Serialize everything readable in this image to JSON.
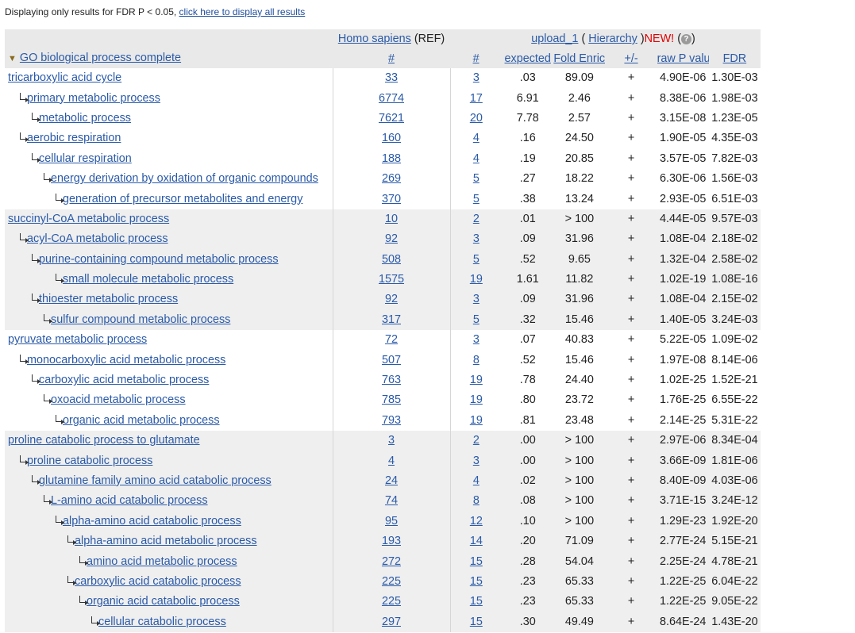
{
  "notice": {
    "text": "Displaying only results for FDR P < 0.05, ",
    "link": "click here to display all results"
  },
  "header": {
    "ref_species": "Homo sapiens",
    "ref_tag": "(REF)",
    "upload_label": "upload_1",
    "paren_open": "(",
    "hierarchy_label": "Hierarchy",
    "paren_close": ")",
    "new_label": "NEW!",
    "help_icon": "?",
    "help_close": ")",
    "annotation_set": "GO biological process complete",
    "cols": {
      "ref_count": "#",
      "count": "#",
      "expected": "expected",
      "fold": "Fold Enrichment",
      "plusminus": "+/-",
      "raw_p": "raw P value",
      "fdr": "FDR"
    }
  },
  "rows": [
    {
      "indent": 0,
      "name": "tricarboxylic acid cycle",
      "ref": "33",
      "n": "3",
      "expected": ".03",
      "fold": "89.09",
      "pm": "+",
      "raw": "4.90E-06",
      "fdr": "1.30E-03",
      "group": 0
    },
    {
      "indent": 1,
      "name": "primary metabolic process",
      "ref": "6774",
      "n": "17",
      "expected": "6.91",
      "fold": "2.46",
      "pm": "+",
      "raw": "8.38E-06",
      "fdr": "1.98E-03",
      "group": 0
    },
    {
      "indent": 2,
      "name": "metabolic process",
      "ref": "7621",
      "n": "20",
      "expected": "7.78",
      "fold": "2.57",
      "pm": "+",
      "raw": "3.15E-08",
      "fdr": "1.23E-05",
      "group": 0
    },
    {
      "indent": 1,
      "name": "aerobic respiration",
      "ref": "160",
      "n": "4",
      "expected": ".16",
      "fold": "24.50",
      "pm": "+",
      "raw": "1.90E-05",
      "fdr": "4.35E-03",
      "group": 0
    },
    {
      "indent": 2,
      "name": "cellular respiration",
      "ref": "188",
      "n": "4",
      "expected": ".19",
      "fold": "20.85",
      "pm": "+",
      "raw": "3.57E-05",
      "fdr": "7.82E-03",
      "group": 0
    },
    {
      "indent": 3,
      "name": "energy derivation by oxidation of organic compounds",
      "ref": "269",
      "n": "5",
      "expected": ".27",
      "fold": "18.22",
      "pm": "+",
      "raw": "6.30E-06",
      "fdr": "1.56E-03",
      "group": 0
    },
    {
      "indent": 4,
      "name": "generation of precursor metabolites and energy",
      "ref": "370",
      "n": "5",
      "expected": ".38",
      "fold": "13.24",
      "pm": "+",
      "raw": "2.93E-05",
      "fdr": "6.51E-03",
      "group": 0
    },
    {
      "indent": 0,
      "name": "succinyl-CoA metabolic process",
      "ref": "10",
      "n": "2",
      "expected": ".01",
      "fold": "> 100",
      "pm": "+",
      "raw": "4.44E-05",
      "fdr": "9.57E-03",
      "group": 1
    },
    {
      "indent": 1,
      "name": "acyl-CoA metabolic process",
      "ref": "92",
      "n": "3",
      "expected": ".09",
      "fold": "31.96",
      "pm": "+",
      "raw": "1.08E-04",
      "fdr": "2.18E-02",
      "group": 1
    },
    {
      "indent": 2,
      "name": "purine-containing compound metabolic process",
      "ref": "508",
      "n": "5",
      "expected": ".52",
      "fold": "9.65",
      "pm": "+",
      "raw": "1.32E-04",
      "fdr": "2.58E-02",
      "group": 1
    },
    {
      "indent": 4,
      "name": "small molecule metabolic process",
      "ref": "1575",
      "n": "19",
      "expected": "1.61",
      "fold": "11.82",
      "pm": "+",
      "raw": "1.02E-19",
      "fdr": "1.08E-16",
      "group": 1
    },
    {
      "indent": 2,
      "name": "thioester metabolic process",
      "ref": "92",
      "n": "3",
      "expected": ".09",
      "fold": "31.96",
      "pm": "+",
      "raw": "1.08E-04",
      "fdr": "2.15E-02",
      "group": 1
    },
    {
      "indent": 3,
      "name": "sulfur compound metabolic process",
      "ref": "317",
      "n": "5",
      "expected": ".32",
      "fold": "15.46",
      "pm": "+",
      "raw": "1.40E-05",
      "fdr": "3.24E-03",
      "group": 1
    },
    {
      "indent": 0,
      "name": "pyruvate metabolic process",
      "ref": "72",
      "n": "3",
      "expected": ".07",
      "fold": "40.83",
      "pm": "+",
      "raw": "5.22E-05",
      "fdr": "1.09E-02",
      "group": 0
    },
    {
      "indent": 1,
      "name": "monocarboxylic acid metabolic process",
      "ref": "507",
      "n": "8",
      "expected": ".52",
      "fold": "15.46",
      "pm": "+",
      "raw": "1.97E-08",
      "fdr": "8.14E-06",
      "group": 0
    },
    {
      "indent": 2,
      "name": "carboxylic acid metabolic process",
      "ref": "763",
      "n": "19",
      "expected": ".78",
      "fold": "24.40",
      "pm": "+",
      "raw": "1.02E-25",
      "fdr": "1.52E-21",
      "group": 0
    },
    {
      "indent": 3,
      "name": "oxoacid metabolic process",
      "ref": "785",
      "n": "19",
      "expected": ".80",
      "fold": "23.72",
      "pm": "+",
      "raw": "1.76E-25",
      "fdr": "6.55E-22",
      "group": 0
    },
    {
      "indent": 4,
      "name": "organic acid metabolic process",
      "ref": "793",
      "n": "19",
      "expected": ".81",
      "fold": "23.48",
      "pm": "+",
      "raw": "2.14E-25",
      "fdr": "5.31E-22",
      "group": 0
    },
    {
      "indent": 0,
      "name": "proline catabolic process to glutamate",
      "ref": "3",
      "n": "2",
      "expected": ".00",
      "fold": "> 100",
      "pm": "+",
      "raw": "2.97E-06",
      "fdr": "8.34E-04",
      "group": 1
    },
    {
      "indent": 1,
      "name": "proline catabolic process",
      "ref": "4",
      "n": "3",
      "expected": ".00",
      "fold": "> 100",
      "pm": "+",
      "raw": "3.66E-09",
      "fdr": "1.81E-06",
      "group": 1
    },
    {
      "indent": 2,
      "name": "glutamine family amino acid catabolic process",
      "ref": "24",
      "n": "4",
      "expected": ".02",
      "fold": "> 100",
      "pm": "+",
      "raw": "8.40E-09",
      "fdr": "4.03E-06",
      "group": 1
    },
    {
      "indent": 3,
      "name": "L-amino acid catabolic process",
      "ref": "74",
      "n": "8",
      "expected": ".08",
      "fold": "> 100",
      "pm": "+",
      "raw": "3.71E-15",
      "fdr": "3.24E-12",
      "group": 1
    },
    {
      "indent": 4,
      "name": "alpha-amino acid catabolic process",
      "ref": "95",
      "n": "12",
      "expected": ".10",
      "fold": "> 100",
      "pm": "+",
      "raw": "1.29E-23",
      "fdr": "1.92E-20",
      "group": 1
    },
    {
      "indent": 5,
      "name": "alpha-amino acid metabolic process",
      "ref": "193",
      "n": "14",
      "expected": ".20",
      "fold": "71.09",
      "pm": "+",
      "raw": "2.77E-24",
      "fdr": "5.15E-21",
      "group": 1
    },
    {
      "indent": 6,
      "name": "amino acid metabolic process",
      "ref": "272",
      "n": "15",
      "expected": ".28",
      "fold": "54.04",
      "pm": "+",
      "raw": "2.25E-24",
      "fdr": "4.78E-21",
      "group": 1
    },
    {
      "indent": 5,
      "name": "carboxylic acid catabolic process",
      "ref": "225",
      "n": "15",
      "expected": ".23",
      "fold": "65.33",
      "pm": "+",
      "raw": "1.22E-25",
      "fdr": "6.04E-22",
      "group": 1
    },
    {
      "indent": 6,
      "name": "organic acid catabolic process",
      "ref": "225",
      "n": "15",
      "expected": ".23",
      "fold": "65.33",
      "pm": "+",
      "raw": "1.22E-25",
      "fdr": "9.05E-22",
      "group": 1
    },
    {
      "indent": 7,
      "name": "cellular catabolic process",
      "ref": "297",
      "n": "15",
      "expected": ".30",
      "fold": "49.49",
      "pm": "+",
      "raw": "8.64E-24",
      "fdr": "1.43E-20",
      "group": 1
    }
  ]
}
